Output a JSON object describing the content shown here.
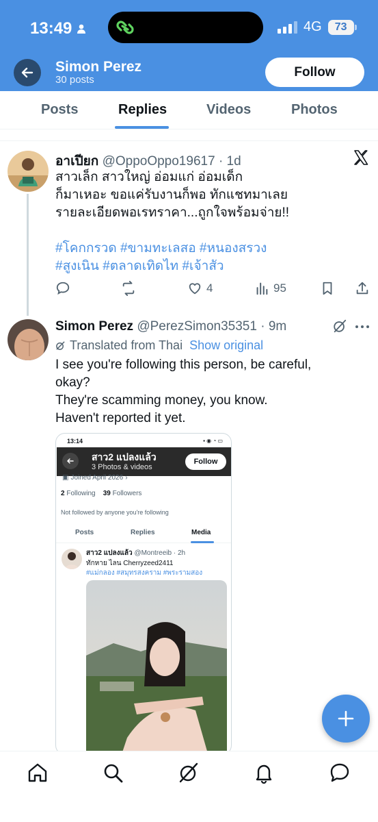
{
  "status_bar": {
    "time": "13:49",
    "network": "4G",
    "battery": "73"
  },
  "header": {
    "name": "Simon Perez",
    "posts": "30 posts",
    "follow_label": "Follow"
  },
  "tabs": [
    {
      "label": "Posts",
      "active": false
    },
    {
      "label": "Replies",
      "active": true
    },
    {
      "label": "Videos",
      "active": false
    },
    {
      "label": "Photos",
      "active": false
    }
  ],
  "tweet1": {
    "name": "อาเปียก",
    "handle": "@OppoOppo19617",
    "time": "· 1d",
    "lines": [
      "สาวเล็ก สาวใหญ่ อ่อมแก่ อ่อมเด็ก",
      "ก็มาเหอะ ขอแค่รับงานก็พอ ทักแชทมาเลย",
      "รายละเอียดพอเรทราคา...ถูกใจพร้อมจ่าย!!"
    ],
    "hashtags_line1": "#โคกกรวด #ขามทะเลสอ #หนองสรวง",
    "hashtags_line2": "#สูงเนิน #ตลาดเทิดไท #เจ้าสัว",
    "likes": "4",
    "views": "95"
  },
  "tweet2": {
    "name": "Simon Perez",
    "handle": "@PerezSimon35351",
    "time": "· 9m",
    "translated": "Translated from Thai",
    "show_original": "Show original",
    "lines": [
      "I see you're following this person, be careful,",
      "okay?",
      "They're scamming money, you know.",
      "Haven't reported it yet."
    ]
  },
  "embed": {
    "time": "13:14",
    "name": "สาว2 แปลงแล้ว",
    "sub": "3 Photos & videos",
    "follow_label": "Follow",
    "joined": "Joined April 2026",
    "following_count": "2",
    "following_label": "Following",
    "followers_count": "39",
    "followers_label": "Followers",
    "not_followed": "Not followed by anyone you're following",
    "tabs": [
      "Posts",
      "Replies",
      "Media"
    ],
    "post_name": "สาว2 แปลงแล้ว",
    "post_handle": "@Montreeib · 2h",
    "post_text": "ทักหาย ไลน Cherryzeed2411",
    "post_tags": "#แม่กลอง #สมุทรสงคราม #พระรามสอง"
  },
  "colors": {
    "accent": "#4a90e2",
    "text": "#0f1419",
    "muted": "#536471"
  }
}
